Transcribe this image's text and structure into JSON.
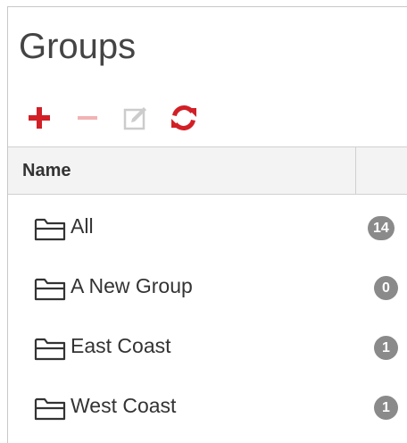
{
  "panel": {
    "title": "Groups"
  },
  "toolbar": {
    "add": {
      "icon": "plus-icon",
      "color": "#d21f26",
      "enabled": true
    },
    "remove": {
      "icon": "minus-icon",
      "color": "#f2b3b5",
      "enabled": false
    },
    "edit": {
      "icon": "edit-icon",
      "color": "#c9c9c9",
      "enabled": false
    },
    "refresh": {
      "icon": "refresh-icon",
      "color": "#d21f26",
      "enabled": true
    }
  },
  "table": {
    "columns": [
      {
        "label": "Name"
      },
      {
        "label": ""
      }
    ],
    "rows": [
      {
        "label": "All",
        "count": "14",
        "icon": "folder-icon"
      },
      {
        "label": "A New Group",
        "count": "0",
        "icon": "folder-icon"
      },
      {
        "label": "East Coast",
        "count": "1",
        "icon": "folder-icon"
      },
      {
        "label": "West Coast",
        "count": "1",
        "icon": "folder-icon"
      }
    ]
  },
  "colors": {
    "accent": "#d21f26",
    "badge": "#8a8a8a",
    "header_bg": "#f3f3f3"
  }
}
